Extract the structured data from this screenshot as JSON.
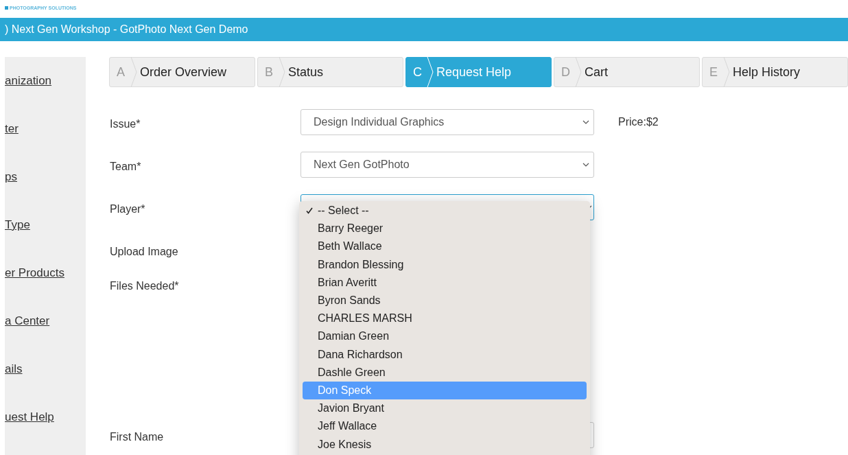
{
  "logo": {
    "tagline": "PHOTOGRAPHY SOLUTIONS"
  },
  "banner": {
    "title": ") Next Gen Workshop - GotPhoto Next Gen Demo"
  },
  "sidebar": {
    "items": [
      {
        "label": "anization"
      },
      {
        "label": "ter"
      },
      {
        "label": "ps"
      },
      {
        "label": "Type"
      },
      {
        "label": "er Products"
      },
      {
        "label": "a Center"
      },
      {
        "label": "ails"
      },
      {
        "label": "uest Help"
      }
    ]
  },
  "steps": [
    {
      "letter": "A",
      "label": "Order Overview",
      "selected": false
    },
    {
      "letter": "B",
      "label": "Status",
      "selected": false
    },
    {
      "letter": "C",
      "label": "Request Help",
      "selected": true
    },
    {
      "letter": "D",
      "label": "Cart",
      "selected": false
    },
    {
      "letter": "E",
      "label": "Help History",
      "selected": false
    }
  ],
  "form": {
    "fields": [
      {
        "kind": "select",
        "label": "Issue*",
        "value": "Design Individual Graphics",
        "note": "Price:$2"
      },
      {
        "kind": "select",
        "label": "Team*",
        "value": "Next Gen GotPhoto"
      },
      {
        "kind": "open-select",
        "label": "Player*"
      },
      {
        "kind": "file",
        "label": "Upload Image"
      },
      {
        "kind": "files",
        "label": "Files Needed*"
      },
      {
        "kind": "text",
        "label": "First Name"
      }
    ]
  },
  "player_menu": {
    "options": [
      {
        "label": "-- Select --",
        "selected": true,
        "highlighted": false
      },
      {
        "label": "Barry Reeger",
        "selected": false,
        "highlighted": false
      },
      {
        "label": "Beth Wallace",
        "selected": false,
        "highlighted": false
      },
      {
        "label": "Brandon Blessing",
        "selected": false,
        "highlighted": false
      },
      {
        "label": "Brian Averitt",
        "selected": false,
        "highlighted": false
      },
      {
        "label": "Byron Sands",
        "selected": false,
        "highlighted": false
      },
      {
        "label": "CHARLES MARSH",
        "selected": false,
        "highlighted": false
      },
      {
        "label": "Damian Green",
        "selected": false,
        "highlighted": false
      },
      {
        "label": "Dana Richardson",
        "selected": false,
        "highlighted": false
      },
      {
        "label": "Dashle Green",
        "selected": false,
        "highlighted": false
      },
      {
        "label": "Don Speck",
        "selected": false,
        "highlighted": true
      },
      {
        "label": "Javion Bryant",
        "selected": false,
        "highlighted": false
      },
      {
        "label": "Jeff Wallace",
        "selected": false,
        "highlighted": false
      },
      {
        "label": "Joe Knesis",
        "selected": false,
        "highlighted": false
      }
    ]
  }
}
